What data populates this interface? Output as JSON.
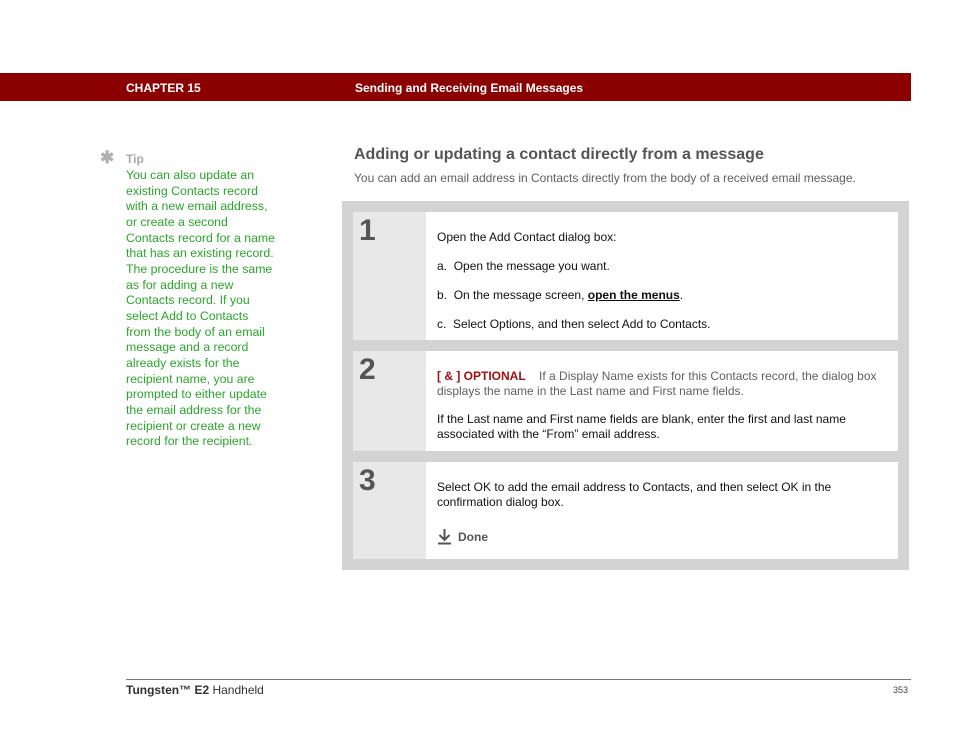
{
  "header": {
    "chapter": "CHAPTER 15",
    "chapter_title": "Sending and Receiving Email Messages",
    "bar_color": "#8b0000"
  },
  "tip": {
    "icon": "asterisk-icon",
    "label": "Tip",
    "body": "You can also update an existing Contacts record with a new email address, or create a second Contacts record for a name that has an existing record. The procedure is the same as for adding a new Contacts record. If you select Add to Contacts from the body of an email message and a record already exists for the recipient name, you are prompted to either update the email address for the recipient or create a new record for the recipient.",
    "text_color": "#2aa52a"
  },
  "section": {
    "title": "Adding or updating a contact directly from a message",
    "intro": "You can add an email address in Contacts directly from the body of a received email message."
  },
  "steps": [
    {
      "number": "1",
      "lead": "Open the Add Contact dialog box:",
      "items": [
        {
          "marker": "a.",
          "text": "Open the message you want."
        },
        {
          "marker": "b.",
          "text_before": "On the message screen, ",
          "link": "open the menus",
          "text_after": "."
        },
        {
          "marker": "c.",
          "text": "Select Options, and then select Add to Contacts."
        }
      ]
    },
    {
      "number": "2",
      "optional_tag": "[ & ]  OPTIONAL",
      "optional_text": "If a Display Name exists for this Contacts record, the dialog box displays the name in the Last name and First name fields.",
      "body": "If the Last name and First name fields are blank, enter the first and last name associated with the “From” email address."
    },
    {
      "number": "3",
      "body": "Select OK to add the email address to Contacts, and then select OK in the confirmation dialog box.",
      "done_icon": "down-arrow-icon",
      "done_label": "Done"
    }
  ],
  "footer": {
    "product_bold": "Tungsten™ E2",
    "product_rest": " Handheld",
    "page_number": "353"
  }
}
